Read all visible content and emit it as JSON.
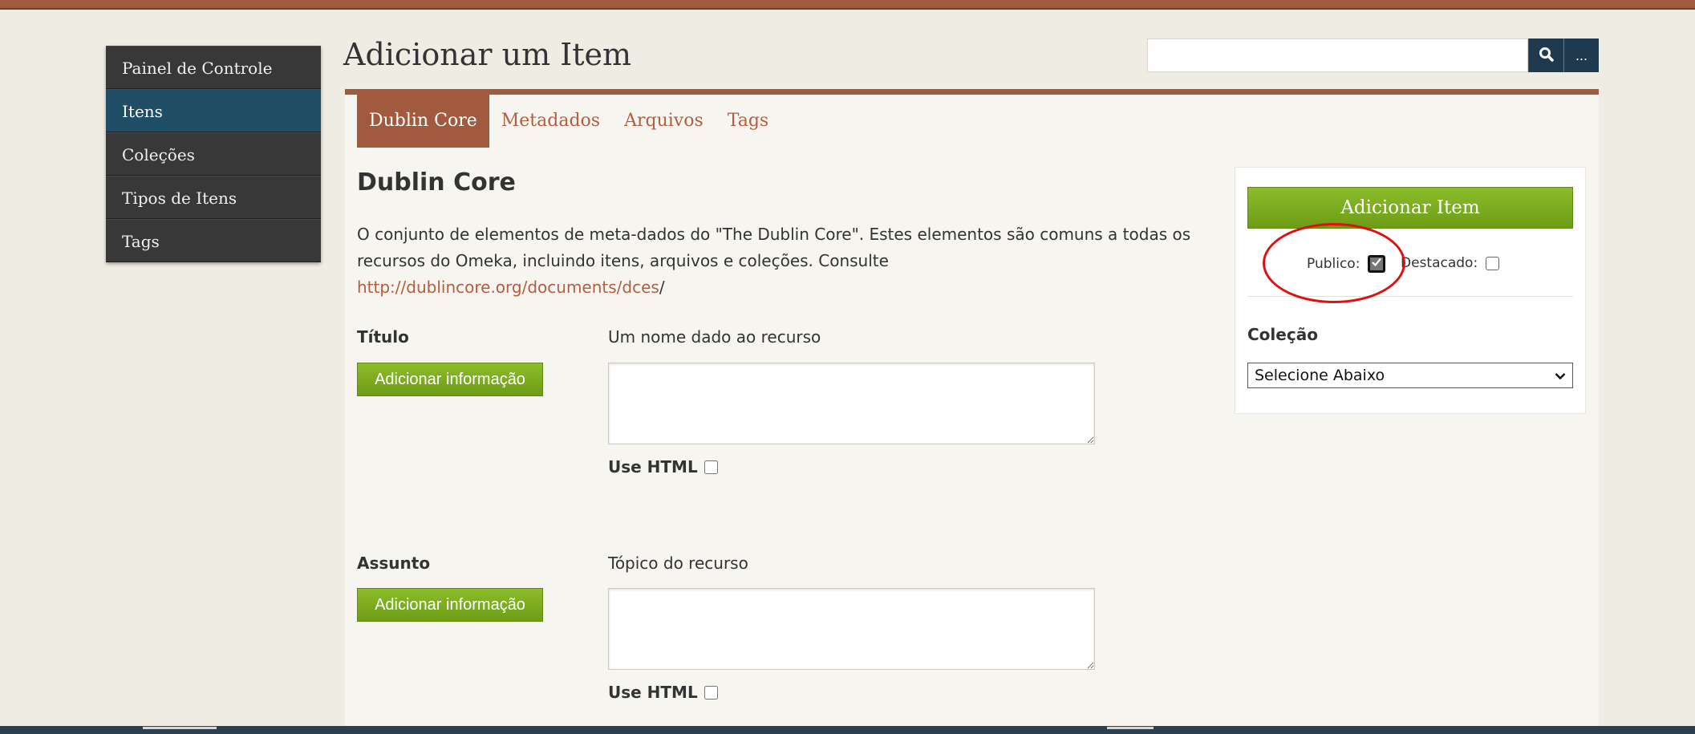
{
  "sidebar": {
    "items": [
      {
        "label": "Painel de Controle"
      },
      {
        "label": "Itens"
      },
      {
        "label": "Coleções"
      },
      {
        "label": "Tipos de Itens"
      },
      {
        "label": "Tags"
      }
    ],
    "active_index": 1
  },
  "header": {
    "title": "Adicionar um Item",
    "search": {
      "value": "",
      "more_label": "..."
    }
  },
  "tabs": [
    {
      "label": "Dublin Core"
    },
    {
      "label": "Metadados"
    },
    {
      "label": "Arquivos"
    },
    {
      "label": "Tags"
    }
  ],
  "section": {
    "heading": "Dublin Core",
    "desc_text": "O conjunto de elementos de meta-dados do \"The Dublin Core\". Estes elementos são comuns a todas os recursos do Omeka, incluindo itens, arquivos e coleções. Consulte ",
    "desc_link": "http://dublincore.org/documents/dces",
    "desc_suffix": "/"
  },
  "fields": [
    {
      "label": "Título",
      "description": "Um nome dado ao recurso",
      "add_label": "Adicionar informação",
      "use_html_label": "Use HTML",
      "use_html_checked": false
    },
    {
      "label": "Assunto",
      "description": "Tópico do recurso",
      "add_label": "Adicionar informação",
      "use_html_label": "Use HTML",
      "use_html_checked": false
    }
  ],
  "side": {
    "add_item_label": "Adicionar Item",
    "public_label": "Publico:",
    "public_checked": true,
    "featured_label": "Destacado:",
    "featured_checked": false,
    "collection_label": "Coleção",
    "collection_selected": "Selecione Abaixo"
  },
  "colors": {
    "accent": "#a25a3e",
    "sidebar_bg": "#383838",
    "sidebar_active": "#1f4e66",
    "button_green": "#7aab1d",
    "link": "#b25e3f",
    "highlight": "#e01010"
  },
  "icons": {
    "search": "search-icon",
    "checkmark": "checkmark-icon",
    "dropdown": "chevron-down-icon"
  }
}
